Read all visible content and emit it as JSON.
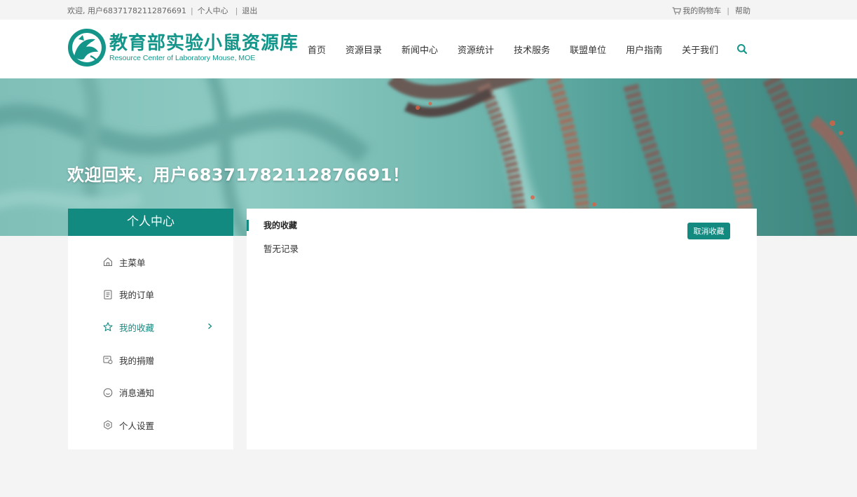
{
  "topbar": {
    "welcome": "欢迎, 用户68371782112876691",
    "personal_center": "个人中心",
    "logout": "退出",
    "cart": "我的购物车",
    "help": "帮助",
    "cart_icon": "cart-icon"
  },
  "header": {
    "logo_cn": "教育部实验小鼠资源库",
    "logo_en": "Resource Center of Laboratory Mouse,  MOE",
    "nav": [
      {
        "label": "首页"
      },
      {
        "label": "资源目录"
      },
      {
        "label": "新闻中心"
      },
      {
        "label": "资源统计"
      },
      {
        "label": "技术服务"
      },
      {
        "label": "联盟单位"
      },
      {
        "label": "用户指南"
      },
      {
        "label": "关于我们"
      }
    ],
    "search_icon": "search-icon"
  },
  "banner": {
    "title": "欢迎回来，用户68371782112876691！"
  },
  "sidebar": {
    "title": "个人中心",
    "items": [
      {
        "label": "主菜单",
        "icon": "home-icon"
      },
      {
        "label": "我的订单",
        "icon": "document-icon"
      },
      {
        "label": "我的收藏",
        "icon": "star-icon",
        "active": true
      },
      {
        "label": "我的捐赠",
        "icon": "donation-icon"
      },
      {
        "label": "消息通知",
        "icon": "message-icon"
      },
      {
        "label": "个人设置",
        "icon": "settings-icon"
      }
    ]
  },
  "content": {
    "title": "我的收藏",
    "cancel_button": "取消收藏",
    "empty_text": "暂无记录"
  },
  "colors": {
    "primary": "#138a80",
    "logo": "#13958a",
    "background": "#f4f4f4"
  }
}
